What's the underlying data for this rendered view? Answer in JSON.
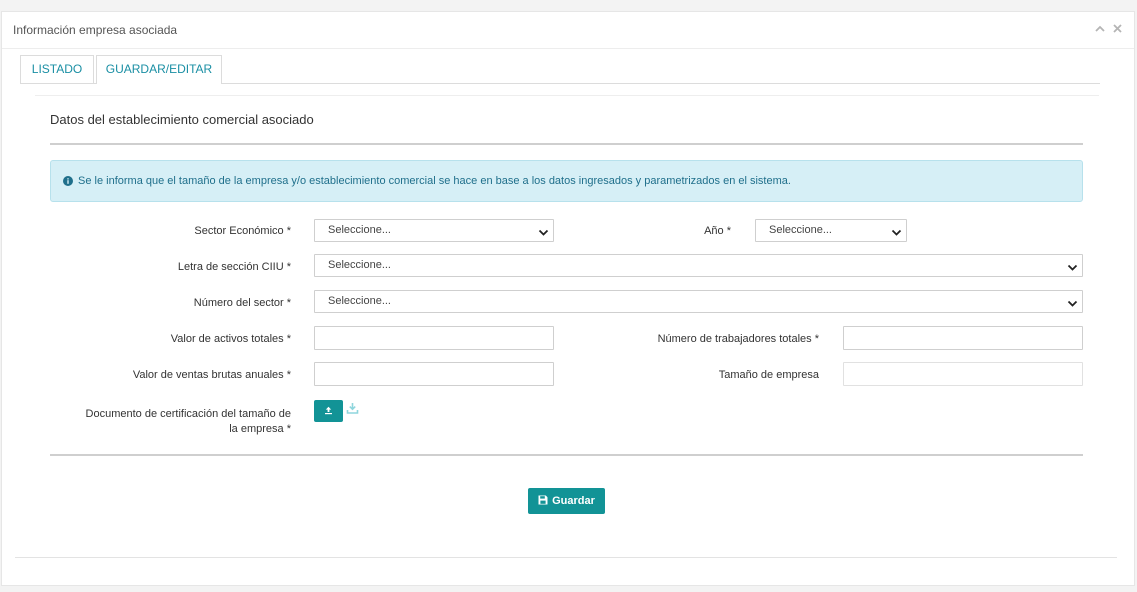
{
  "panel": {
    "title": "Información empresa asociada"
  },
  "tabs": [
    {
      "label": "LISTADO"
    },
    {
      "label": "GUARDAR/EDITAR"
    }
  ],
  "section": {
    "title": "Datos del establecimiento comercial asociado"
  },
  "alert": {
    "text": "Se le informa que el tamaño de la empresa y/o establecimiento comercial se hace en base a los datos ingresados y parametrizados en el sistema."
  },
  "form": {
    "sector_label": "Sector Económico *",
    "sector_value": "Seleccione...",
    "year_label": "Año *",
    "year_value": "Seleccione...",
    "ciiu_label": "Letra de sección CIIU *",
    "ciiu_value": "Seleccione...",
    "sector_number_label": "Número del sector *",
    "sector_number_value": "Seleccione...",
    "assets_label": "Valor de activos totales *",
    "assets_value": "",
    "workers_label": "Número de trabajadores totales *",
    "workers_value": "",
    "sales_label": "Valor de ventas brutas anuales *",
    "sales_value": "",
    "size_label": "Tamaño de empresa",
    "size_value": "",
    "doc_label_line1": "Documento de certificación del tamaño de",
    "doc_label_line2": "la empresa *"
  },
  "actions": {
    "save_label": "Guardar"
  },
  "colors": {
    "accent": "#129396",
    "tab_text": "#1a8fa4",
    "alert_bg": "#d6eff6",
    "alert_text": "#1f6f8b"
  }
}
